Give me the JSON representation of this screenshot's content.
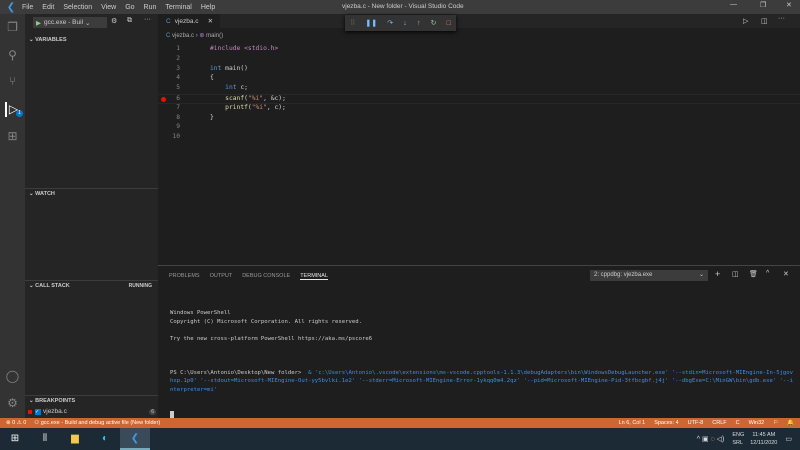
{
  "titlebar": {
    "menu": [
      "File",
      "Edit",
      "Selection",
      "View",
      "Go",
      "Run",
      "Terminal",
      "Help"
    ],
    "title": "vjezba.c - New folder - Visual Studio Code"
  },
  "debug_toolbar": [
    "drag-handle",
    "pause",
    "step-over",
    "step-into",
    "step-out",
    "restart",
    "stop"
  ],
  "sidebar": {
    "config": "gcc.exe - Buil",
    "variables": "VARIABLES",
    "watch": "WATCH",
    "callstack": "CALL STACK",
    "callstack_status": "RUNNING",
    "breakpoints": "BREAKPOINTS",
    "bp_file": "vjezba.c",
    "bp_line": "6"
  },
  "activity_badge": "1",
  "editor": {
    "tab": "vjezba.c",
    "breadcrumb_file": "vjezba.c",
    "breadcrumb_symbol": "main()",
    "lines": [
      {
        "n": "1",
        "t": "#include <stdio.h>"
      },
      {
        "n": "2",
        "t": ""
      },
      {
        "n": "3",
        "t": "int main()"
      },
      {
        "n": "4",
        "t": "{"
      },
      {
        "n": "5",
        "t": "    int c;"
      },
      {
        "n": "6",
        "t": "    scanf(\"%i\", &c);"
      },
      {
        "n": "7",
        "t": "    printf(\"%i\", c);"
      },
      {
        "n": "8",
        "t": "}"
      },
      {
        "n": "9",
        "t": ""
      },
      {
        "n": "10",
        "t": ""
      }
    ]
  },
  "panel": {
    "tabs": [
      "PROBLEMS",
      "OUTPUT",
      "DEBUG CONSOLE",
      "TERMINAL"
    ],
    "terminal_select": "2: cppdbg: vjezba.exe",
    "term_lines": [
      "Windows PowerShell",
      "Copyright (C) Microsoft Corporation. All rights reserved.",
      "",
      "Try the new cross-platform PowerShell https://aka.ms/pscore6",
      ""
    ],
    "prompt": "PS C:\\Users\\Antonio\\Desktop\\New folder> ",
    "command": " & 'c:\\Users\\Antonio\\.vscode\\extensions\\ms-vscode.cpptools-1.1.3\\debugAdapters\\bin\\WindowsDebugLauncher.exe' '--stdin=Microsoft-MIEngine-In-5jgovhxp.1p0' '--stdout=Microsoft-MIEngine-Out-yy5bvlki.1e2' '--stderr=Microsoft-MIEngine-Error-1ykqq0m4.2qz' '--pid=Microsoft-MIEngine-Pid-3tfbcgbf.j4j' '--dbgExe=C:\\MinGW\\bin\\gdb.exe' '--interpreter=mi'"
  },
  "status": {
    "errors": "0",
    "warnings": "0",
    "debug": "gcc.exe - Build and debug active file (New folder)",
    "position": "Ln 6, Col 1",
    "spaces": "Spaces: 4",
    "encoding": "UTF-8",
    "eol": "CRLF",
    "lang": "C",
    "platform": "Win32"
  },
  "taskbar": {
    "lang1": "ENG",
    "lang2": "SRL",
    "time": "11:45 AM",
    "date": "12/11/2020"
  },
  "colors": {
    "status": "#cc6633",
    "accent": "#007acc"
  }
}
